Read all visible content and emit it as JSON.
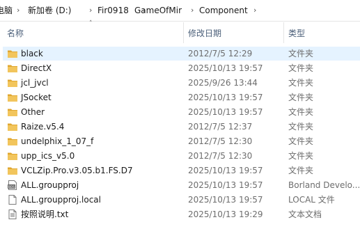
{
  "breadcrumb": {
    "items": [
      "电脑",
      "新加卷 (D:)",
      "Fir0918",
      "GameOfMir",
      "Component"
    ]
  },
  "columns": {
    "name": "名称",
    "date": "修改日期",
    "type": "类型"
  },
  "colors": {
    "selection": "#e5f3ff",
    "folder": "#f2c55c",
    "header_text": "#4c607a"
  },
  "files": [
    {
      "name": "black",
      "date": "2012/7/5 12:29",
      "type": "文件夹",
      "icon": "folder-icon",
      "selected": true
    },
    {
      "name": "DirectX",
      "date": "2025/10/13 19:57",
      "type": "文件夹",
      "icon": "folder-icon"
    },
    {
      "name": "jcl_jvcl",
      "date": "2025/9/26 13:44",
      "type": "文件夹",
      "icon": "folder-icon"
    },
    {
      "name": "JSocket",
      "date": "2025/10/13 19:57",
      "type": "文件夹",
      "icon": "folder-icon"
    },
    {
      "name": "Other",
      "date": "2025/10/13 19:57",
      "type": "文件夹",
      "icon": "folder-icon"
    },
    {
      "name": "Raize.v5.4",
      "date": "2012/7/5 12:37",
      "type": "文件夹",
      "icon": "folder-icon"
    },
    {
      "name": "undelphix_1_07_f",
      "date": "2012/7/5 12:30",
      "type": "文件夹",
      "icon": "folder-icon"
    },
    {
      "name": "upp_ics_v5.0",
      "date": "2012/7/5 12:30",
      "type": "文件夹",
      "icon": "folder-icon"
    },
    {
      "name": "VCLZip.Pro.v3.05.b1.FS.D7",
      "date": "2025/10/13 19:57",
      "type": "文件夹",
      "icon": "folder-icon"
    },
    {
      "name": "ALL.groupproj",
      "date": "2025/10/13 19:57",
      "type": "Borland Develo...",
      "icon": "groupproj-file-icon"
    },
    {
      "name": "ALL.groupproj.local",
      "date": "2025/10/13 19:57",
      "type": "LOCAL 文件",
      "icon": "generic-file-icon"
    },
    {
      "name": "按照说明.txt",
      "date": "2025/10/13 19:29",
      "type": "文本文档",
      "icon": "text-file-icon"
    }
  ]
}
